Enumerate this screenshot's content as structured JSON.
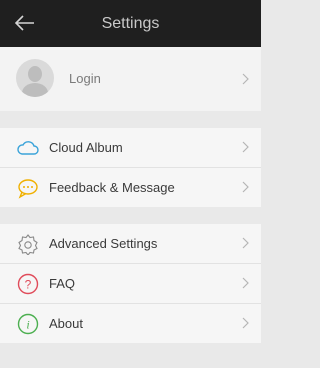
{
  "header": {
    "title": "Settings"
  },
  "profile": {
    "login_label": "Login"
  },
  "group1": [
    {
      "label": "Cloud Album"
    },
    {
      "label": "Feedback & Message"
    }
  ],
  "group2": [
    {
      "label": "Advanced Settings"
    },
    {
      "label": "FAQ"
    },
    {
      "label": "About"
    }
  ],
  "colors": {
    "header_bg": "#1f1f1f",
    "cloud_icon": "#3aa3d9",
    "feedback_icon": "#f0b000",
    "faq_icon": "#e04b5a",
    "about_icon": "#4caf50"
  },
  "icons": [
    "back-arrow-icon",
    "cloud-icon",
    "chat-icon",
    "gear-icon",
    "question-icon",
    "info-icon",
    "chevron-right-icon"
  ]
}
